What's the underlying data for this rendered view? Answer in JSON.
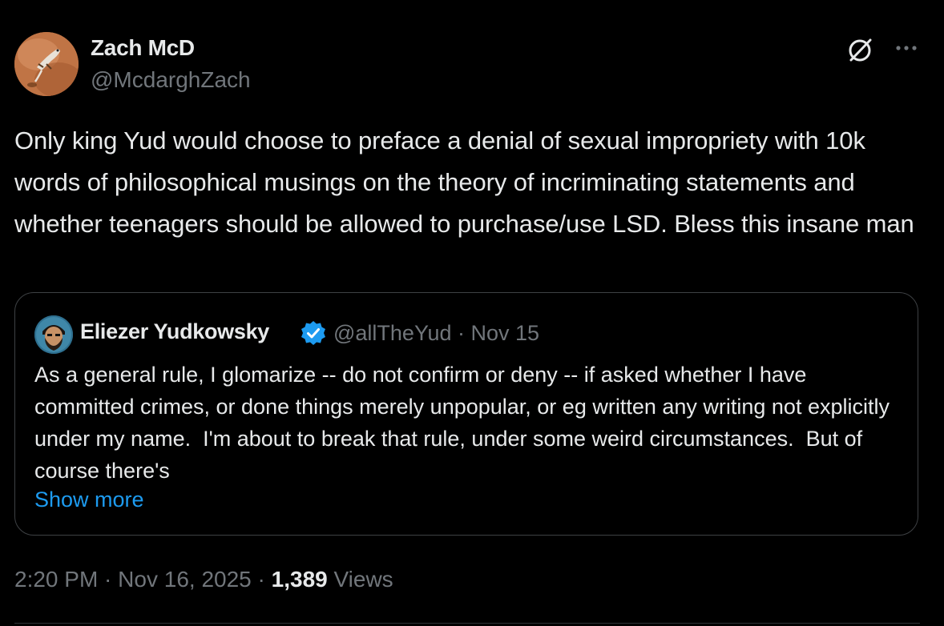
{
  "author": {
    "display_name": "Zach McD",
    "handle": "@McdarghZach",
    "avatar_icon": "avatar-desert-lizard"
  },
  "actions": {
    "grok_icon": "grok-icon",
    "more_icon": "more-icon"
  },
  "tweet": {
    "text": "Only king Yud would choose to preface a denial of sexual impropriety with 10k words of philosophical musings on the theory of incriminating statements and whether teenagers should be allowed to purchase/use LSD. Bless this insane man"
  },
  "quote": {
    "display_name": "Eliezer Yudkowsky",
    "verified_icon": "verified-badge-icon",
    "handle": "@allTheYud",
    "separator": " · ",
    "date": "Nov 15",
    "text": "As a general rule, I glomarize -- do not confirm or deny -- if asked whether I have committed crimes, or done things merely unpopular, or eg written any writing not explicitly under my name.  I'm about to break that rule, under some weird circumstances.  But of course there's",
    "show_more": "Show more"
  },
  "footer": {
    "time": "2:20 PM",
    "sep1": " · ",
    "date": "Nov 16, 2025",
    "sep2": " · ",
    "views_count": "1,389",
    "views_label": " Views"
  },
  "colors": {
    "background": "#000000",
    "text_primary": "#e7e9ea",
    "text_secondary": "#71767b",
    "link": "#1d9bf0",
    "border": "#3e4144"
  }
}
